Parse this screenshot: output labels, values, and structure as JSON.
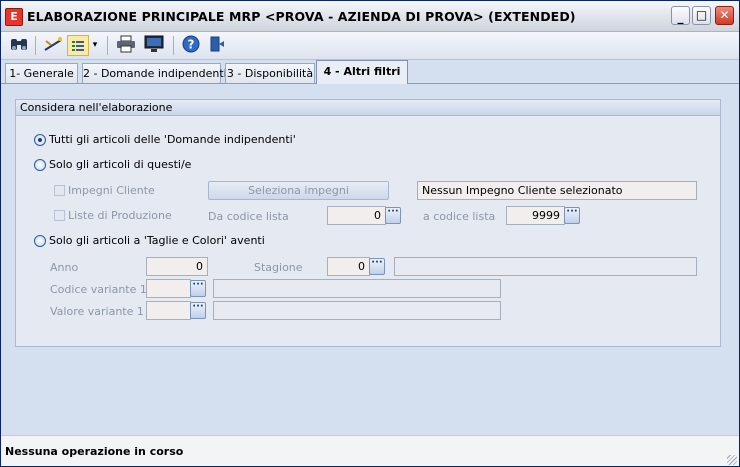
{
  "window": {
    "title": "ELABORAZIONE PRINCIPALE MRP <PROVA - AZIENDA DI PROVA> (EXTENDED)",
    "app_icon_letter": "E",
    "controls": {
      "minimize": "_",
      "maximize": "□",
      "close": "✕"
    }
  },
  "toolbar": {
    "buttons": [
      {
        "name": "binoculars-icon",
        "glyph": "⚯"
      },
      {
        "name": "wand-icon",
        "glyph": "⟋"
      },
      {
        "name": "list-options-icon",
        "glyph": "☷"
      },
      {
        "name": "dropdown-arrow-icon",
        "glyph": "▾"
      },
      {
        "name": "printer-icon",
        "glyph": "⎙"
      },
      {
        "name": "monitor-icon",
        "glyph": "▭"
      },
      {
        "name": "help-icon",
        "glyph": "?"
      },
      {
        "name": "exit-door-icon",
        "glyph": "⇥"
      }
    ]
  },
  "tabs": [
    {
      "label": "1- Generale",
      "active": false
    },
    {
      "label": "2 - Domande indipendenti",
      "active": false
    },
    {
      "label": "3 - Disponibilità",
      "active": false
    },
    {
      "label": "4 - Altri filtri",
      "active": true
    }
  ],
  "group": {
    "title": "Considera nell'elaborazione",
    "radio_all_articles": "Tutti gli articoli delle 'Domande indipendenti'",
    "radio_only_these": "Solo gli articoli di questi/e",
    "check_impegni": "Impegni Cliente",
    "button_seleziona": "Seleziona impegni",
    "impegni_value": "Nessun Impegno Cliente selezionato",
    "check_liste": "Liste di Produzione",
    "label_da_codice": "Da codice lista",
    "da_codice_value": "0",
    "label_a_codice": "a codice lista",
    "a_codice_value": "9999",
    "radio_taglie": "Solo gli articoli a 'Taglie e Colori' aventi",
    "label_anno": "Anno",
    "anno_value": "0",
    "label_stagione": "Stagione",
    "stagione_value": "0",
    "label_codice_variante": "Codice variante 1",
    "label_valore_variante": "Valore variante 1",
    "dots": "···"
  },
  "status": {
    "text": "Nessuna operazione in corso"
  },
  "colors": {
    "accent": "#2d5b9c",
    "close": "#d03a28",
    "app_icon": "#e8352a"
  }
}
